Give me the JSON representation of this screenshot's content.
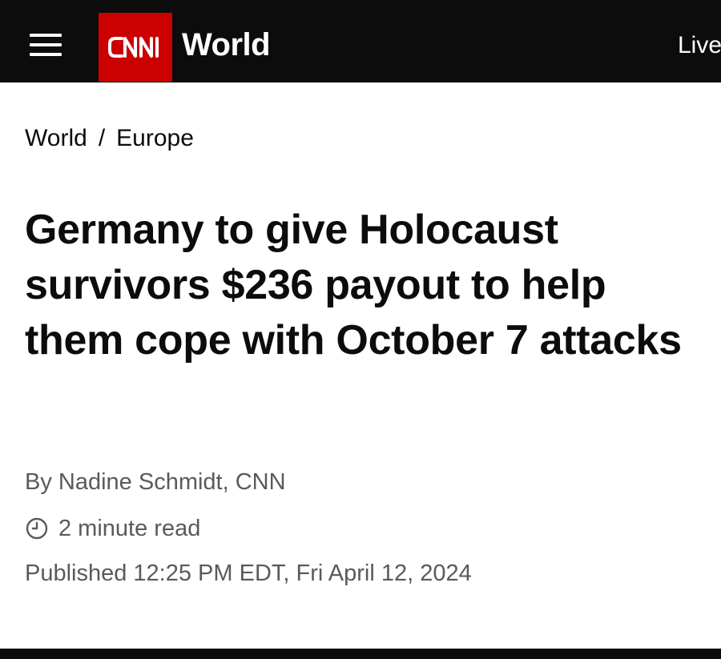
{
  "header": {
    "logo_text": "CNN",
    "section": "World",
    "live_label": "Live",
    "colors": {
      "background": "#0c0c0c",
      "brand_red": "#cc0000",
      "text": "#ffffff"
    }
  },
  "breadcrumb": {
    "items": [
      "World",
      "Europe"
    ],
    "separator": "/"
  },
  "article": {
    "headline": "Germany to give Holocaust survivors $236 payout to help them cope with October 7 attacks",
    "byline": "By Nadine Schmidt, CNN",
    "read_time": "2 minute read",
    "published": "Published 12:25 PM EDT, Fri April 12, 2024",
    "icons": {
      "read_time": "clock-icon"
    },
    "colors": {
      "headline": "#0c0c0c",
      "meta": "#5a5a5a"
    }
  }
}
